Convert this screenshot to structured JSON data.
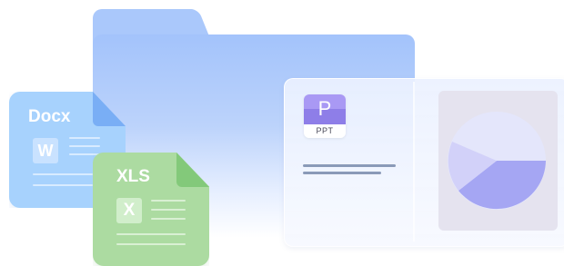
{
  "folder": {
    "color": "#aac8fb"
  },
  "presentation": {
    "badge_letter": "P",
    "badge_label": "PPT",
    "icon_color": "#a999f4",
    "chart": {
      "type": "pie",
      "colors": [
        "#e4e6fb",
        "#a5a6f3",
        "#d2d1f9"
      ]
    }
  },
  "docx": {
    "label": "Docx",
    "badge_letter": "W",
    "color": "#a7d2fd"
  },
  "xls": {
    "label": "XLS",
    "badge_letter": "X",
    "color": "#acdba1"
  }
}
